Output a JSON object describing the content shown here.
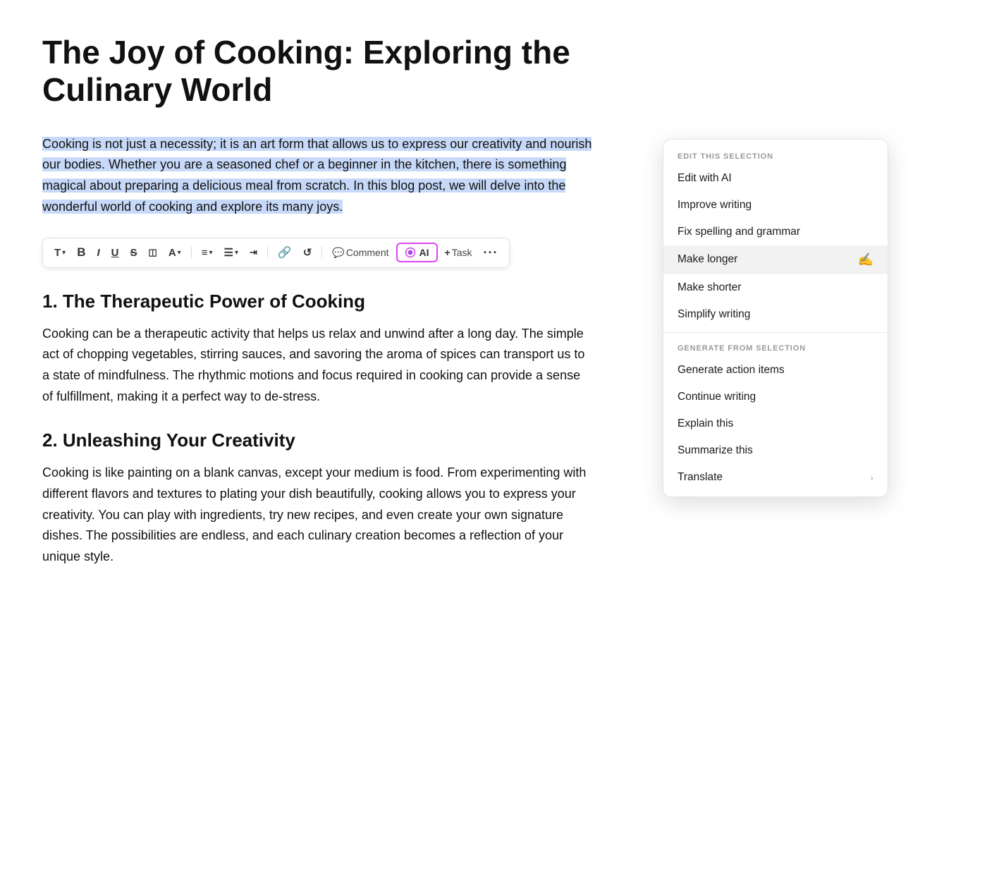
{
  "document": {
    "title": "The Joy of Cooking: Exploring the Culinary World",
    "selected_paragraph": "Cooking is not just a necessity; it is an art form that allows us to express our creativity and nourish our bodies. Whether you are a seasoned chef or a beginner in the kitchen, there is something magical about preparing a delicious meal from scratch. In this blog post, we will delve into the wonderful world of cooking and explore its many joys.",
    "section1_heading": "1. The Therapeutic Power of Cooking",
    "section1_body": "Cooking can be a therapeutic activity that helps us relax and unwind after a long day. The simple act of chopping vegetables, stirring sauces, and savoring the aroma of spices can transport us to a state of mindfulness. The rhythmic motions and focus required in cooking can provide a sense of fulfillment, making it a perfect way to de-stress.",
    "section2_heading": "2. Unleashing Your Creativity",
    "section2_body": "Cooking is like painting on a blank canvas, except your medium is food. From experimenting with different flavors and textures to plating your dish beautifully, cooking allows you to express your creativity. You can play with ingredients, try new recipes, and even create your own signature dishes. The possibilities are endless, and each culinary creation becomes a reflection of your unique style."
  },
  "toolbar": {
    "items": [
      {
        "label": "T",
        "name": "text-style-button",
        "extra": "▾"
      },
      {
        "label": "B",
        "name": "bold-button"
      },
      {
        "label": "I",
        "name": "italic-button"
      },
      {
        "label": "U",
        "name": "underline-button"
      },
      {
        "label": "S",
        "name": "strikethrough-button"
      },
      {
        "label": "⬜",
        "name": "highlight-button"
      },
      {
        "label": "A",
        "name": "color-button",
        "extra": "▾"
      },
      {
        "label": "≡",
        "name": "align-button",
        "extra": "▾"
      },
      {
        "label": "☰",
        "name": "list-button",
        "extra": "▾"
      },
      {
        "label": "⊡",
        "name": "indent-button"
      },
      {
        "label": "🔗",
        "name": "link-button"
      },
      {
        "label": "↺",
        "name": "undo-button"
      },
      {
        "label": "💬",
        "name": "comment-button",
        "text": "Comment"
      },
      {
        "label": "AI",
        "name": "ai-button"
      },
      {
        "label": "+",
        "name": "task-button",
        "text": "Task"
      },
      {
        "label": "···",
        "name": "more-button"
      }
    ]
  },
  "ai_menu": {
    "edit_section_label": "EDIT THIS SELECTION",
    "generate_section_label": "GENERATE FROM SELECTION",
    "edit_items": [
      {
        "label": "Edit with AI",
        "name": "edit-with-ai-item"
      },
      {
        "label": "Improve writing",
        "name": "improve-writing-item"
      },
      {
        "label": "Fix spelling and grammar",
        "name": "fix-spelling-item"
      },
      {
        "label": "Make longer",
        "name": "make-longer-item",
        "hovered": true
      },
      {
        "label": "Make shorter",
        "name": "make-shorter-item"
      },
      {
        "label": "Simplify writing",
        "name": "simplify-writing-item"
      }
    ],
    "generate_items": [
      {
        "label": "Generate action items",
        "name": "generate-action-items-item"
      },
      {
        "label": "Continue writing",
        "name": "continue-writing-item"
      },
      {
        "label": "Explain this",
        "name": "explain-this-item"
      },
      {
        "label": "Summarize this",
        "name": "summarize-this-item"
      },
      {
        "label": "Translate",
        "name": "translate-item",
        "has_arrow": true
      }
    ]
  }
}
